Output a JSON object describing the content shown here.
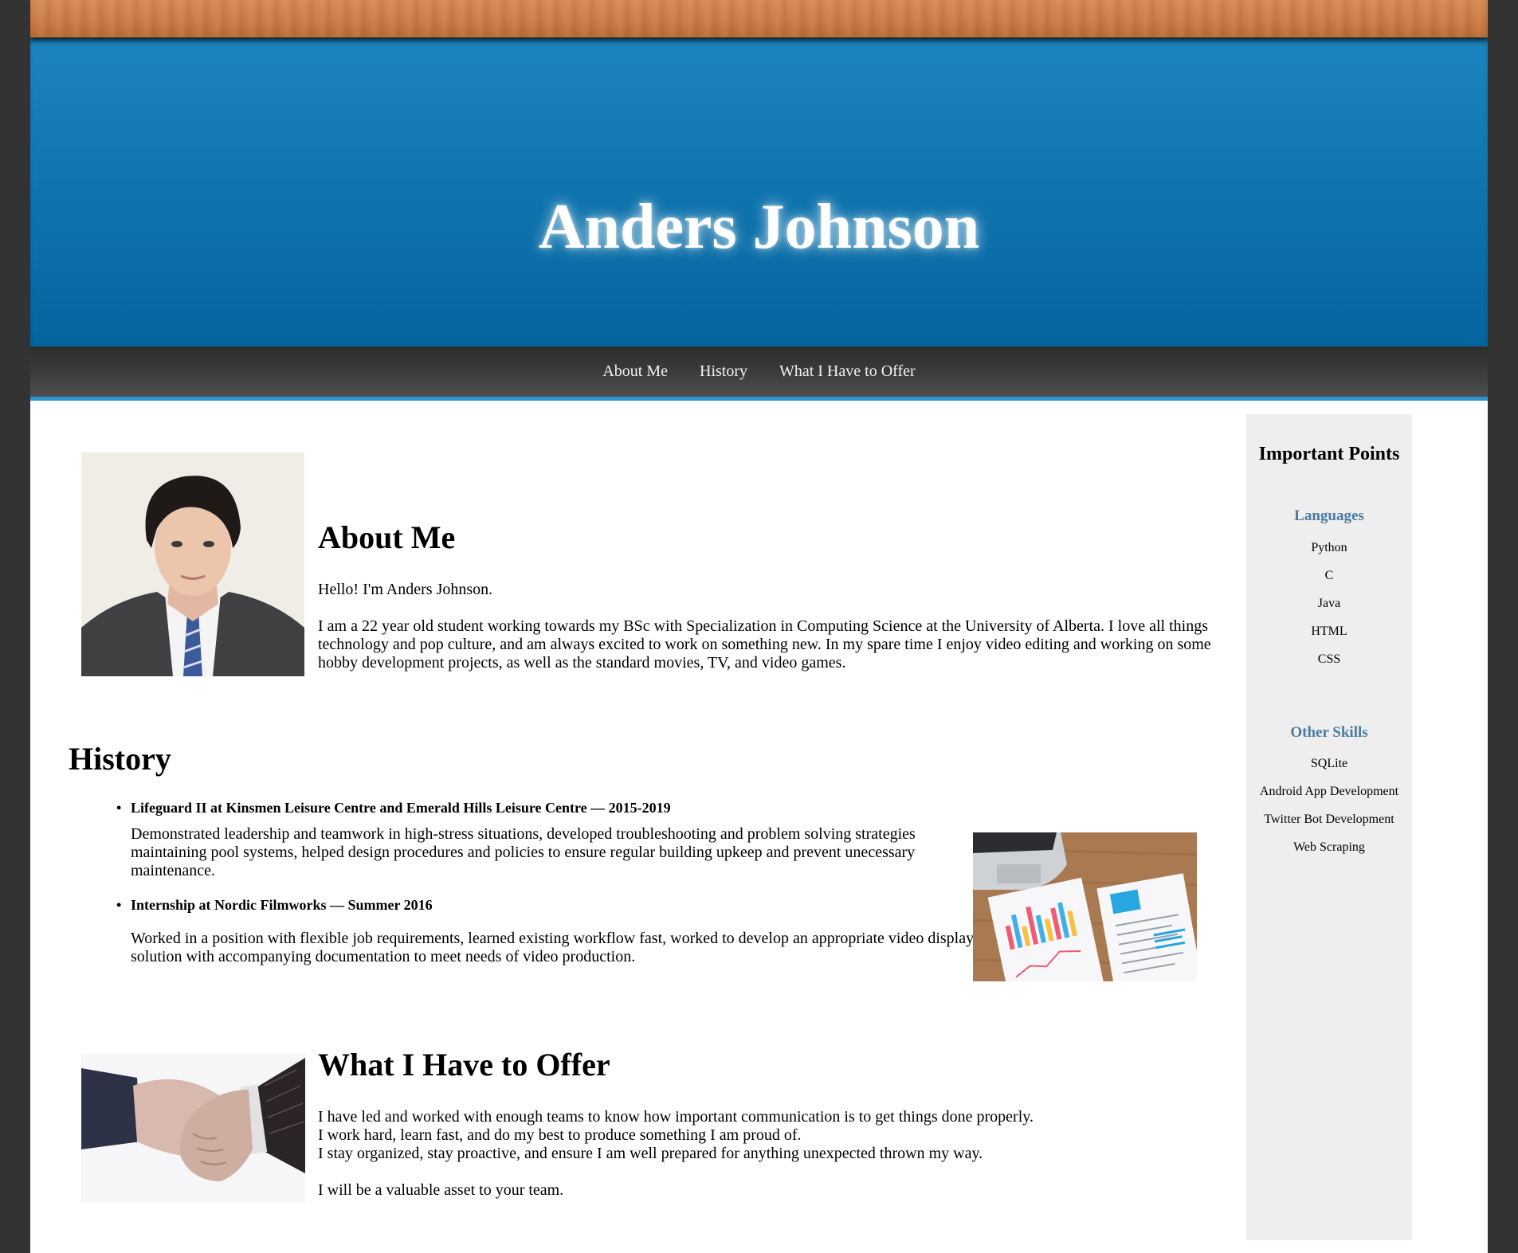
{
  "header": {
    "title": "Anders Johnson"
  },
  "nav": {
    "items": [
      {
        "label": "About Me"
      },
      {
        "label": "History"
      },
      {
        "label": "What I Have to Offer"
      }
    ]
  },
  "about": {
    "heading": "About Me",
    "greeting": "Hello! I'm Anders Johnson.",
    "bio": "I am a 22 year old student working towards my BSc with Specialization in Computing Science at the University of Alberta. I love all things technology and pop culture, and am always excited to work on something new. In my spare time I enjoy video editing and working on some hobby development projects, as well as the standard movies, TV, and video games."
  },
  "history": {
    "heading": "History",
    "jobs": [
      {
        "title": "Lifeguard II at Kinsmen Leisure Centre and Emerald Hills Leisure Centre — 2015-2019",
        "description": "Demonstrated leadership and teamwork in high-stress situations, developed troubleshooting and problem solving strategies maintaining pool systems, helped design procedures and policies to ensure regular building upkeep and prevent unecessary maintenance."
      },
      {
        "title": "Internship at Nordic Filmworks — Summer 2016",
        "description": "Worked in a position with flexible job requirements, learned existing workflow fast, worked to develop an appropriate video display solution with accompanying documentation to meet needs of video production."
      }
    ]
  },
  "offer": {
    "heading": "What I Have to Offer",
    "lines": [
      "I have led and worked with enough teams to know how important communication is to get things done properly.",
      "I work hard, learn fast, and do my best to produce something I am proud of.",
      "I stay organized, stay proactive, and ensure I am well prepared for anything unexpected thrown my way."
    ],
    "closing": "I will be a valuable asset to your team."
  },
  "sidebar": {
    "title": "Important Points",
    "languages": {
      "heading": "Languages",
      "items": [
        "Python",
        "C",
        "Java",
        "HTML",
        "CSS"
      ]
    },
    "other_skills": {
      "heading": "Other Skills",
      "items": [
        "SQLite",
        "Android App Development",
        "Twitter Bot Development",
        "Web Scraping"
      ]
    }
  },
  "colors": {
    "banner_blue": "#1478b4",
    "nav_underline": "#2b93d6",
    "sidebar_heading": "#4a7ba0",
    "sidebar_bg": "#eeeeee",
    "frame_bg": "#333333"
  }
}
